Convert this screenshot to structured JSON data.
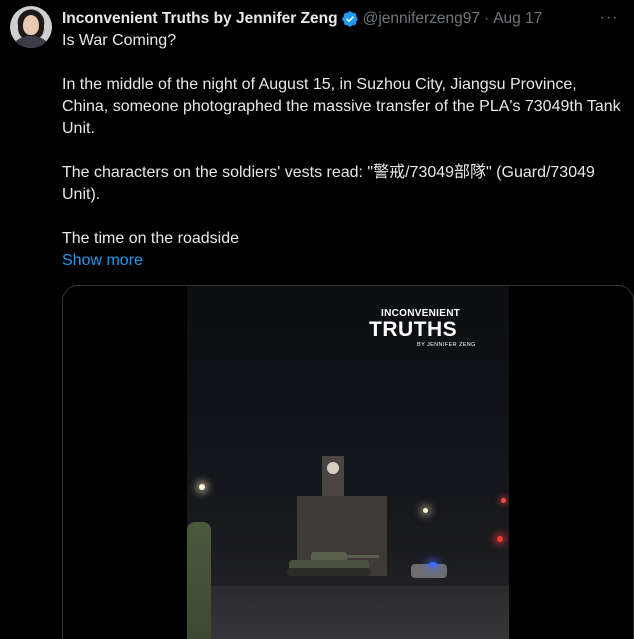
{
  "tweet": {
    "display_name": "Inconvenient Truths by Jennifer Zeng",
    "handle": "@jenniferzeng97",
    "separator": "·",
    "date": "Aug 17",
    "more_icon": "more-horizontal-icon",
    "verified_icon": "verified-badge-icon",
    "verified_color": "#1d9bf0",
    "lines": [
      "Is War Coming?",
      "In the middle of the night of August 15, in Suzhou City, Jiangsu Province, China, someone photographed the massive transfer of the PLA's 73049th Tank Unit.",
      "The characters on the soldiers' vests read: \"警戒/73049部隊\" (Guard/73049 Unit).",
      "The time on the roadside"
    ],
    "show_more": "Show more",
    "link_color": "#1d9bf0"
  },
  "media": {
    "logo_line1": "INCONVENIENT",
    "logo_line2": "TRUTHS",
    "logo_line3": "BY JENNIFER ZENG"
  }
}
